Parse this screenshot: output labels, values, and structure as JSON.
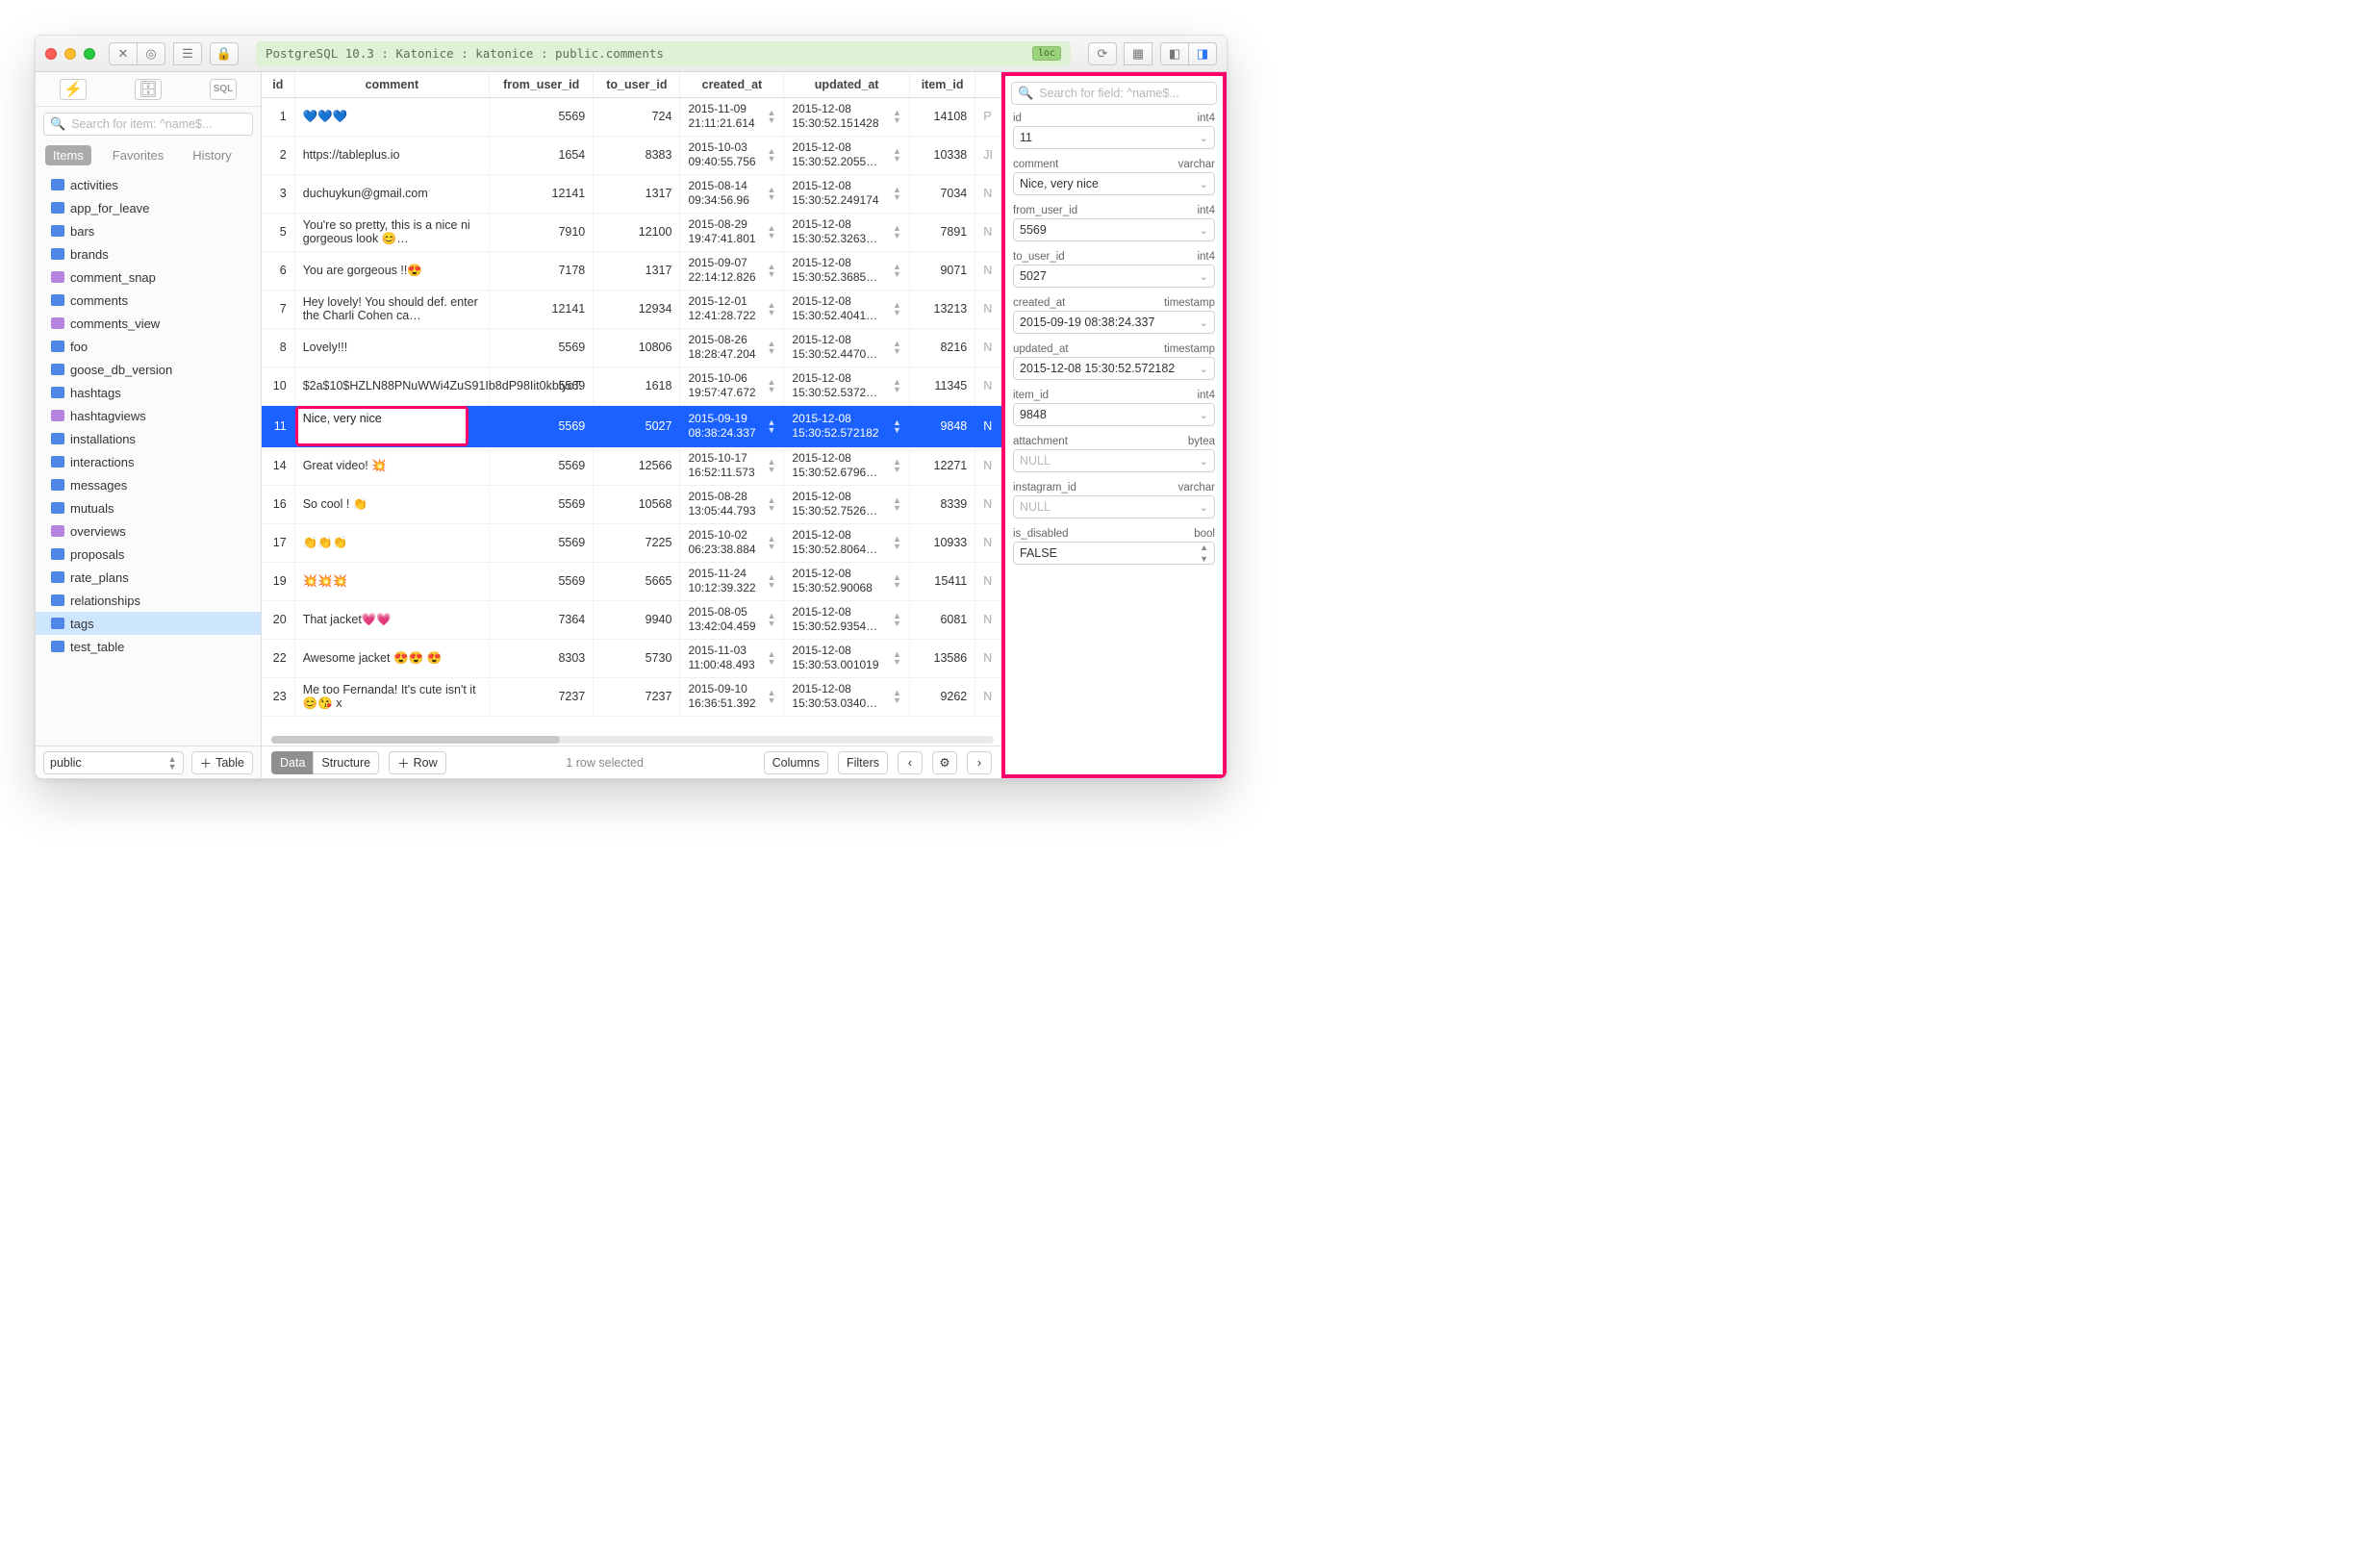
{
  "titlebar": {
    "breadcrumb": "PostgreSQL 10.3 : Katonice : katonice : public.comments",
    "loc_badge": "loc"
  },
  "sidebar": {
    "search_placeholder": "Search for item: ^name$...",
    "tabs": {
      "items": "Items",
      "favorites": "Favorites",
      "history": "History"
    },
    "items": [
      {
        "name": "activities",
        "kind": "table"
      },
      {
        "name": "app_for_leave",
        "kind": "table"
      },
      {
        "name": "bars",
        "kind": "table"
      },
      {
        "name": "brands",
        "kind": "table"
      },
      {
        "name": "comment_snap",
        "kind": "view"
      },
      {
        "name": "comments",
        "kind": "table"
      },
      {
        "name": "comments_view",
        "kind": "view"
      },
      {
        "name": "foo",
        "kind": "table"
      },
      {
        "name": "goose_db_version",
        "kind": "table"
      },
      {
        "name": "hashtags",
        "kind": "table"
      },
      {
        "name": "hashtagviews",
        "kind": "view"
      },
      {
        "name": "installations",
        "kind": "table"
      },
      {
        "name": "interactions",
        "kind": "table"
      },
      {
        "name": "messages",
        "kind": "table"
      },
      {
        "name": "mutuals",
        "kind": "table"
      },
      {
        "name": "overviews",
        "kind": "view"
      },
      {
        "name": "proposals",
        "kind": "table"
      },
      {
        "name": "rate_plans",
        "kind": "table"
      },
      {
        "name": "relationships",
        "kind": "table"
      },
      {
        "name": "tags",
        "kind": "table",
        "selected": true
      },
      {
        "name": "test_table",
        "kind": "table"
      }
    ],
    "schema": "public",
    "add_table": "Table"
  },
  "table": {
    "columns": [
      "id",
      "comment",
      "from_user_id",
      "to_user_id",
      "created_at",
      "updated_at",
      "item_id"
    ],
    "rows": [
      {
        "id": "1",
        "comment": "💙💙💙",
        "from_user_id": "5569",
        "to_user_id": "724",
        "created_at": "2015-11-09 21:11:21.614",
        "updated_at": "2015-12-08 15:30:52.151428",
        "item_id": "14108",
        "tail": "P"
      },
      {
        "id": "2",
        "comment": "https://tableplus.io",
        "from_user_id": "1654",
        "to_user_id": "8383",
        "created_at": "2015-10-03 09:40:55.756",
        "updated_at": "2015-12-08 15:30:52.2055…",
        "item_id": "10338",
        "tail": "JI"
      },
      {
        "id": "3",
        "comment": "duchuykun@gmail.com",
        "from_user_id": "12141",
        "to_user_id": "1317",
        "created_at": "2015-08-14 09:34:56.96",
        "updated_at": "2015-12-08 15:30:52.249174",
        "item_id": "7034",
        "tail": "N"
      },
      {
        "id": "5",
        "comment": "You're so pretty, this is a nice ni gorgeous look 😊…",
        "from_user_id": "7910",
        "to_user_id": "12100",
        "created_at": "2015-08-29 19:47:41.801",
        "updated_at": "2015-12-08 15:30:52.3263…",
        "item_id": "7891",
        "tail": "N"
      },
      {
        "id": "6",
        "comment": "You are gorgeous !!😍",
        "from_user_id": "7178",
        "to_user_id": "1317",
        "created_at": "2015-09-07 22:14:12.826",
        "updated_at": "2015-12-08 15:30:52.3685…",
        "item_id": "9071",
        "tail": "N"
      },
      {
        "id": "7",
        "comment": "Hey lovely! You should def. enter the Charli Cohen ca…",
        "from_user_id": "12141",
        "to_user_id": "12934",
        "created_at": "2015-12-01 12:41:28.722",
        "updated_at": "2015-12-08 15:30:52.4041…",
        "item_id": "13213",
        "tail": "N"
      },
      {
        "id": "8",
        "comment": "Lovely!!!",
        "from_user_id": "5569",
        "to_user_id": "10806",
        "created_at": "2015-08-26 18:28:47.204",
        "updated_at": "2015-12-08 15:30:52.4470…",
        "item_id": "8216",
        "tail": "N"
      },
      {
        "id": "10",
        "comment": "$2a$10$HZLN88PNuWWi4ZuS91Ib8dP98Iit0kblycT",
        "from_user_id": "5569",
        "to_user_id": "1618",
        "created_at": "2015-10-06 19:57:47.672",
        "updated_at": "2015-12-08 15:30:52.5372…",
        "item_id": "11345",
        "tail": "N"
      },
      {
        "id": "11",
        "comment": "Nice, very nice",
        "from_user_id": "5569",
        "to_user_id": "5027",
        "created_at": "2015-09-19 08:38:24.337",
        "updated_at": "2015-12-08 15:30:52.572182",
        "item_id": "9848",
        "tail": "N",
        "selected": true,
        "editing": true
      },
      {
        "id": "14",
        "comment": "Great video! 💥",
        "from_user_id": "5569",
        "to_user_id": "12566",
        "created_at": "2015-10-17 16:52:11.573",
        "updated_at": "2015-12-08 15:30:52.6796…",
        "item_id": "12271",
        "tail": "N"
      },
      {
        "id": "16",
        "comment": "So cool ! 👏",
        "from_user_id": "5569",
        "to_user_id": "10568",
        "created_at": "2015-08-28 13:05:44.793",
        "updated_at": "2015-12-08 15:30:52.7526…",
        "item_id": "8339",
        "tail": "N"
      },
      {
        "id": "17",
        "comment": "👏👏👏",
        "from_user_id": "5569",
        "to_user_id": "7225",
        "created_at": "2015-10-02 06:23:38.884",
        "updated_at": "2015-12-08 15:30:52.8064…",
        "item_id": "10933",
        "tail": "N"
      },
      {
        "id": "19",
        "comment": "💥💥💥",
        "from_user_id": "5569",
        "to_user_id": "5665",
        "created_at": "2015-11-24 10:12:39.322",
        "updated_at": "2015-12-08 15:30:52.90068",
        "item_id": "15411",
        "tail": "N"
      },
      {
        "id": "20",
        "comment": "That jacket💗💗",
        "from_user_id": "7364",
        "to_user_id": "9940",
        "created_at": "2015-08-05 13:42:04.459",
        "updated_at": "2015-12-08 15:30:52.9354…",
        "item_id": "6081",
        "tail": "N"
      },
      {
        "id": "22",
        "comment": "Awesome jacket 😍😍 😍",
        "from_user_id": "8303",
        "to_user_id": "5730",
        "created_at": "2015-11-03 11:00:48.493",
        "updated_at": "2015-12-08 15:30:53.001019",
        "item_id": "13586",
        "tail": "N"
      },
      {
        "id": "23",
        "comment": "Me too Fernanda! It's cute isn't it 😊😘 x",
        "from_user_id": "7237",
        "to_user_id": "7237",
        "created_at": "2015-09-10 16:36:51.392",
        "updated_at": "2015-12-08 15:30:53.0340…",
        "item_id": "9262",
        "tail": "N"
      }
    ]
  },
  "main_footer": {
    "data": "Data",
    "structure": "Structure",
    "row": "Row",
    "status": "1 row selected",
    "columns": "Columns",
    "filters": "Filters"
  },
  "inspector": {
    "search_placeholder": "Search for field: ^name$...",
    "fields": [
      {
        "name": "id",
        "type": "int4",
        "value": "11"
      },
      {
        "name": "comment",
        "type": "varchar",
        "value": "Nice, very nice"
      },
      {
        "name": "from_user_id",
        "type": "int4",
        "value": "5569"
      },
      {
        "name": "to_user_id",
        "type": "int4",
        "value": "5027"
      },
      {
        "name": "created_at",
        "type": "timestamp",
        "value": "2015-09-19 08:38:24.337"
      },
      {
        "name": "updated_at",
        "type": "timestamp",
        "value": "2015-12-08 15:30:52.572182"
      },
      {
        "name": "item_id",
        "type": "int4",
        "value": "9848"
      },
      {
        "name": "attachment",
        "type": "bytea",
        "value": "NULL",
        "null": true
      },
      {
        "name": "instagram_id",
        "type": "varchar",
        "value": "NULL",
        "null": true
      },
      {
        "name": "is_disabled",
        "type": "bool",
        "value": "FALSE",
        "stepper": true
      }
    ]
  }
}
